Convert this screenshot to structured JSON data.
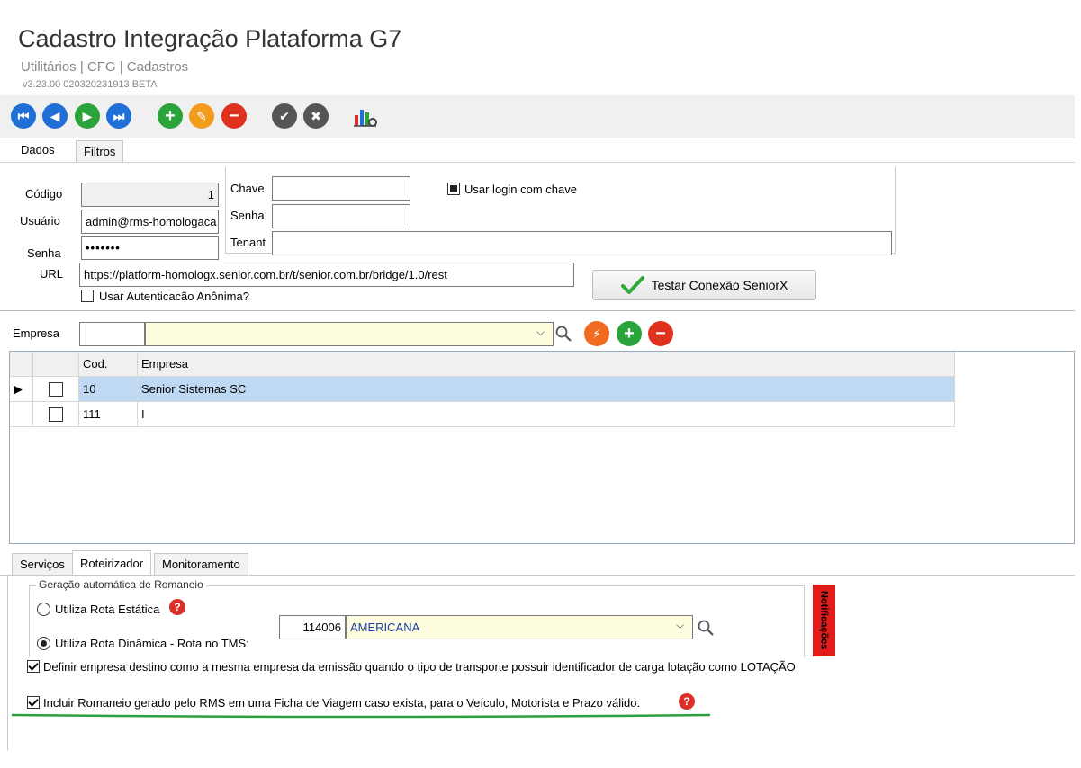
{
  "header": {
    "title": "Cadastro Integração Plataforma G7",
    "breadcrumb": "Utilitários | CFG | Cadastros",
    "version": "v3.23.00 020320231913 BETA"
  },
  "toolbar": {
    "icons": [
      "first-icon",
      "prev-icon",
      "next-icon",
      "last-icon",
      "add-icon",
      "edit-icon",
      "delete-icon",
      "confirm-icon",
      "cancel-icon",
      "report-icon"
    ]
  },
  "tabs_top": [
    {
      "label": "Dados"
    },
    {
      "label": "Filtros"
    }
  ],
  "form": {
    "codigo_label": "Código",
    "codigo_value": "1",
    "usuario_label": "Usuário",
    "usuario_value": "admin@rms-homologaca",
    "senha_label": "Senha",
    "senha_value": "•••••••",
    "url_label": "URL",
    "url_value": "https://platform-homologx.senior.com.br/t/senior.com.br/bridge/1.0/rest",
    "anon_label": "Usar Autenticacão Anônima?",
    "chave_label": "Chave",
    "chave_value": "",
    "senha2_label": "Senha",
    "senha2_value": "",
    "tenant_label": "Tenant",
    "tenant_value": "",
    "login_chave_label": "Usar login com chave",
    "test_button": "Testar Conexão SeniorX"
  },
  "empresa": {
    "label": "Empresa",
    "code_value": "",
    "name_value": ""
  },
  "grid": {
    "headers": [
      "",
      "",
      "Cod.",
      "Empresa"
    ],
    "rows": [
      {
        "cod": "10",
        "empresa": "Senior Sistemas SC",
        "selected": true
      },
      {
        "cod": "111",
        "empresa": "I",
        "selected": false
      }
    ]
  },
  "tabs_bottom": [
    {
      "label": "Serviços"
    },
    {
      "label": "Roteirizador"
    },
    {
      "label": "Monitoramento"
    }
  ],
  "roteirizador": {
    "group_label": "Geração automática de Romaneio",
    "rota_estatica": "Utiliza Rota Estática",
    "rota_dinamica": "Utiliza Rota Dinâmica - Rota no TMS:",
    "rota_code": "114006",
    "rota_name": "AMERICANA",
    "notificacoes": "Notificações",
    "opt1": "Definir empresa destino como a mesma empresa da emissão quando o tipo de transporte possuir identificador de carga lotação como LOTAÇÃO",
    "opt2": "Incluir Romaneio gerado pelo RMS em uma Ficha de Viagem caso exista, para o Veículo, Motorista e Prazo válido."
  },
  "colors": {
    "nav_blue": "#1f6fd6",
    "add_green": "#2aa33b",
    "edit_orange": "#f39b1a",
    "delete_red": "#e0301e",
    "selection": "#bfd9f3",
    "highlight_line": "#2e9e3e"
  }
}
